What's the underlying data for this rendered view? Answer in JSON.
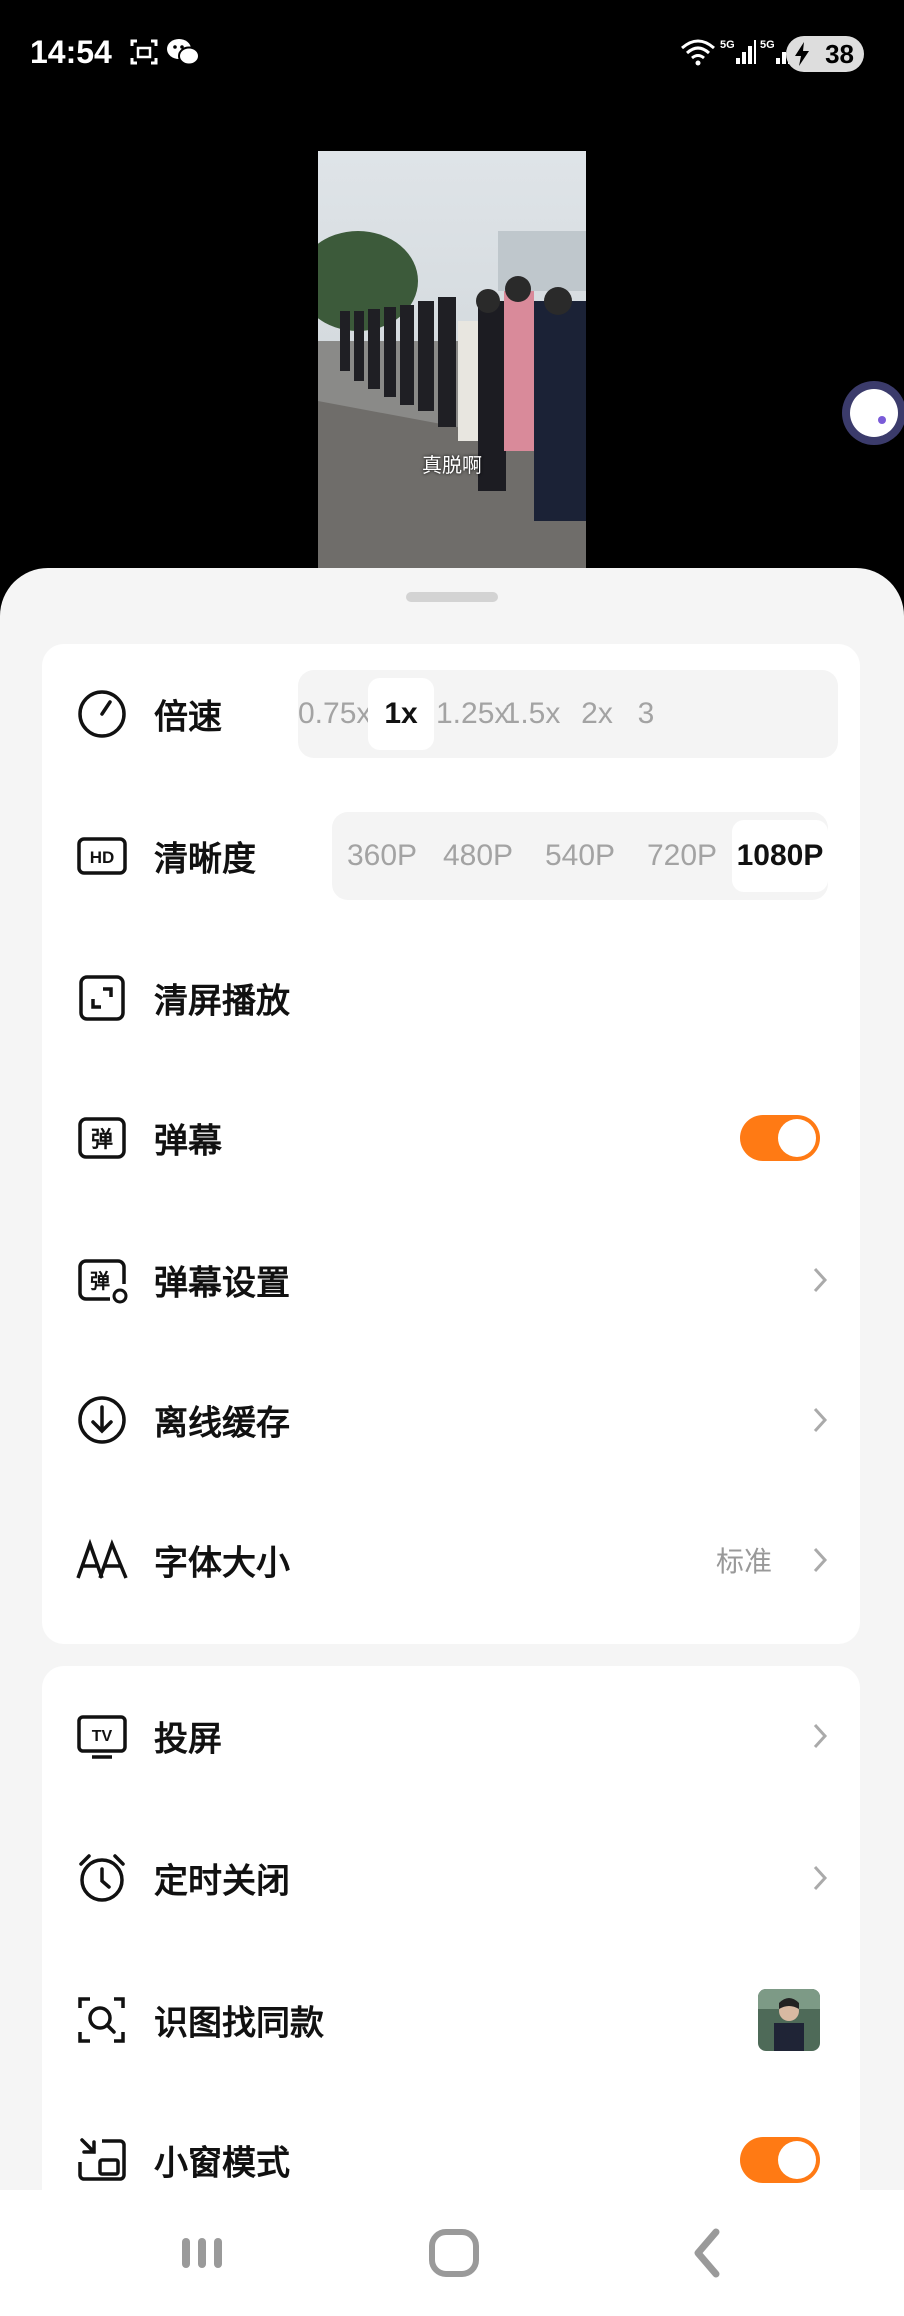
{
  "status_bar": {
    "time": "14:54",
    "battery": "38"
  },
  "video": {
    "subtitle": "真脱啊"
  },
  "speed": {
    "label": "倍速",
    "options": [
      "0.75x",
      "1x",
      "1.25x",
      "1.5x",
      "2x",
      "3"
    ],
    "selected": "1x"
  },
  "quality": {
    "label": "清晰度",
    "options": [
      "360P",
      "480P",
      "540P",
      "720P",
      "1080P"
    ],
    "selected": "1080P"
  },
  "clear_screen": {
    "label": "清屏播放"
  },
  "danmaku": {
    "label": "弹幕",
    "enabled": true
  },
  "danmaku_settings": {
    "label": "弹幕设置"
  },
  "offline_cache": {
    "label": "离线缓存"
  },
  "font_size": {
    "label": "字体大小",
    "value": "标准"
  },
  "cast": {
    "label": "投屏"
  },
  "timer": {
    "label": "定时关闭"
  },
  "image_search": {
    "label": "识图找同款"
  },
  "pip": {
    "label": "小窗模式",
    "enabled": true
  },
  "icons": {
    "speed": "speedometer-icon",
    "quality": "hd-icon",
    "clear": "fullscreen-icon",
    "danmaku": "danmaku-icon",
    "danmaku_settings": "danmaku-settings-icon",
    "download": "download-icon",
    "font": "font-size-icon",
    "cast": "tv-cast-icon",
    "timer": "alarm-clock-icon",
    "scan": "image-search-icon",
    "pip": "picture-in-picture-icon"
  },
  "colors": {
    "accent": "#ff7a14",
    "sheet_bg": "#f5f5f5",
    "muted_text": "#a3a3a3"
  }
}
